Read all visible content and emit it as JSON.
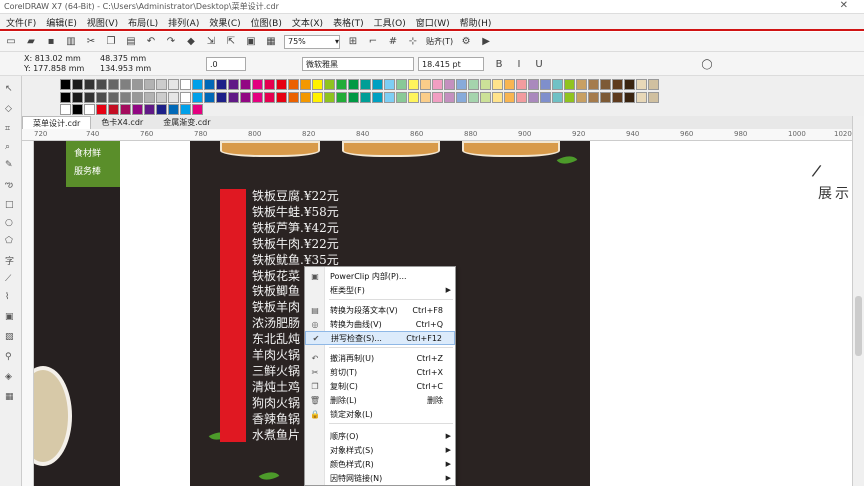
{
  "window": {
    "title": "CorelDRAW X7 (64-Bit) - C:\\Users\\Administrator\\Desktop\\菜单设计.cdr",
    "close_glyph": "✕"
  },
  "menubar": [
    "文件(F)",
    "编辑(E)",
    "视图(V)",
    "布局(L)",
    "排列(A)",
    "效果(C)",
    "位图(B)",
    "文本(X)",
    "表格(T)",
    "工具(O)",
    "窗口(W)",
    "帮助(H)"
  ],
  "toolbar": {
    "zoom": "75%",
    "snap": "贴齐(T)"
  },
  "propbar": {
    "x": "X: 813.02 mm",
    "y": "Y: 177.858 mm",
    "w": "48.375 mm",
    "h": "134.953 mm",
    "angle": ".0",
    "font": "微软雅黑",
    "size": "18.415 pt"
  },
  "tabs": [
    "菜单设计.cdr",
    "色卡X4.cdr",
    "金属渐变.cdr"
  ],
  "ruler": [
    "720",
    "740",
    "760",
    "780",
    "800",
    "820",
    "840",
    "860",
    "880",
    "900",
    "920",
    "940",
    "960",
    "980",
    "1000",
    "1020"
  ],
  "palette": {
    "row1": [
      "#000000",
      "#1a1a1a",
      "#333333",
      "#4d4d4d",
      "#666666",
      "#808080",
      "#999999",
      "#b3b3b3",
      "#cccccc",
      "#e6e6e6",
      "#ffffff",
      "#00a0e9",
      "#0068b7",
      "#1d2088",
      "#601986",
      "#920783",
      "#e4007f",
      "#e5004f",
      "#e60012",
      "#eb6100",
      "#f39800",
      "#fff100",
      "#8fc31f",
      "#22ac38",
      "#009944",
      "#009e96",
      "#00a0c1",
      "#7ecef4",
      "#89c997",
      "#fff45c",
      "#facd89",
      "#f19ec2",
      "#c490bf",
      "#88abda",
      "#a5d4ad",
      "#cce198",
      "#ffe38b",
      "#f8b551",
      "#f29c9f",
      "#aa89bd",
      "#7f8fcc",
      "#6fc1c5",
      "#90c31f",
      "#c8a063",
      "#a57b4c",
      "#7d5a35",
      "#5e3b1e",
      "#3a2410",
      "#e8d8b8",
      "#d0c0a0"
    ],
    "row2": [
      "#ffffff",
      "#000000",
      "#ffffff",
      "#e60012",
      "#c30d23",
      "#a40b5d",
      "#920783",
      "#601986",
      "#1d2088",
      "#0068b7",
      "#00a0e9",
      "#e4007f"
    ]
  },
  "design": {
    "left_green_tab": [
      "食材鲜",
      "服务棒"
    ],
    "menu_items": [
      "铁板豆腐.¥22元",
      "铁板牛蛙.¥58元",
      "铁板芦笋.¥42元",
      "铁板牛肉.¥22元",
      "铁板鱿鱼.¥35元",
      "铁板花菜",
      "铁板鲫鱼",
      "铁板羊肉",
      "浓汤肥肠",
      "东北乱炖",
      "羊肉火锅",
      "三鲜火锅",
      "清炖土鸡",
      "狗肉火锅",
      "香辣鱼锅",
      "水煮鱼片"
    ],
    "side_text": "展示",
    "side_glyph": "/"
  },
  "context_menu": [
    {
      "icon": "powerclip-icon",
      "glyph": "▣",
      "label": "PowerClip 内部(P)...",
      "shortcut": "",
      "arrow": false
    },
    {
      "icon": "",
      "glyph": "",
      "label": "框类型(F)",
      "shortcut": "",
      "arrow": true
    },
    {
      "icon": "convert-text-icon",
      "glyph": "▤",
      "label": "转换为段落文本(V)",
      "shortcut": "Ctrl+F8",
      "arrow": false
    },
    {
      "icon": "convert-curve-icon",
      "glyph": "◎",
      "label": "转换为曲线(V)",
      "shortcut": "Ctrl+Q",
      "arrow": false
    },
    {
      "icon": "spellcheck-icon",
      "glyph": "✔",
      "label": "拼写检查(S)...",
      "shortcut": "Ctrl+F12",
      "arrow": false,
      "highlight": true
    },
    {
      "icon": "undo-icon",
      "glyph": "↶",
      "label": "撤消再制(U)",
      "shortcut": "Ctrl+Z",
      "arrow": false
    },
    {
      "icon": "cut-icon",
      "glyph": "✂",
      "label": "剪切(T)",
      "shortcut": "Ctrl+X",
      "arrow": false
    },
    {
      "icon": "copy-icon",
      "glyph": "❐",
      "label": "复制(C)",
      "shortcut": "Ctrl+C",
      "arrow": false
    },
    {
      "icon": "delete-icon",
      "glyph": "🗑",
      "label": "删除(L)",
      "shortcut": "删除",
      "arrow": false
    },
    {
      "icon": "lock-icon",
      "glyph": "🔒",
      "label": "锁定对象(L)",
      "shortcut": "",
      "arrow": false
    },
    {
      "icon": "",
      "glyph": "",
      "label": "顺序(O)",
      "shortcut": "",
      "arrow": true
    },
    {
      "icon": "",
      "glyph": "",
      "label": "对象样式(S)",
      "shortcut": "",
      "arrow": true
    },
    {
      "icon": "",
      "glyph": "",
      "label": "颜色样式(R)",
      "shortcut": "",
      "arrow": true
    },
    {
      "icon": "",
      "glyph": "",
      "label": "因特网链接(N)",
      "shortcut": "",
      "arrow": true
    }
  ]
}
